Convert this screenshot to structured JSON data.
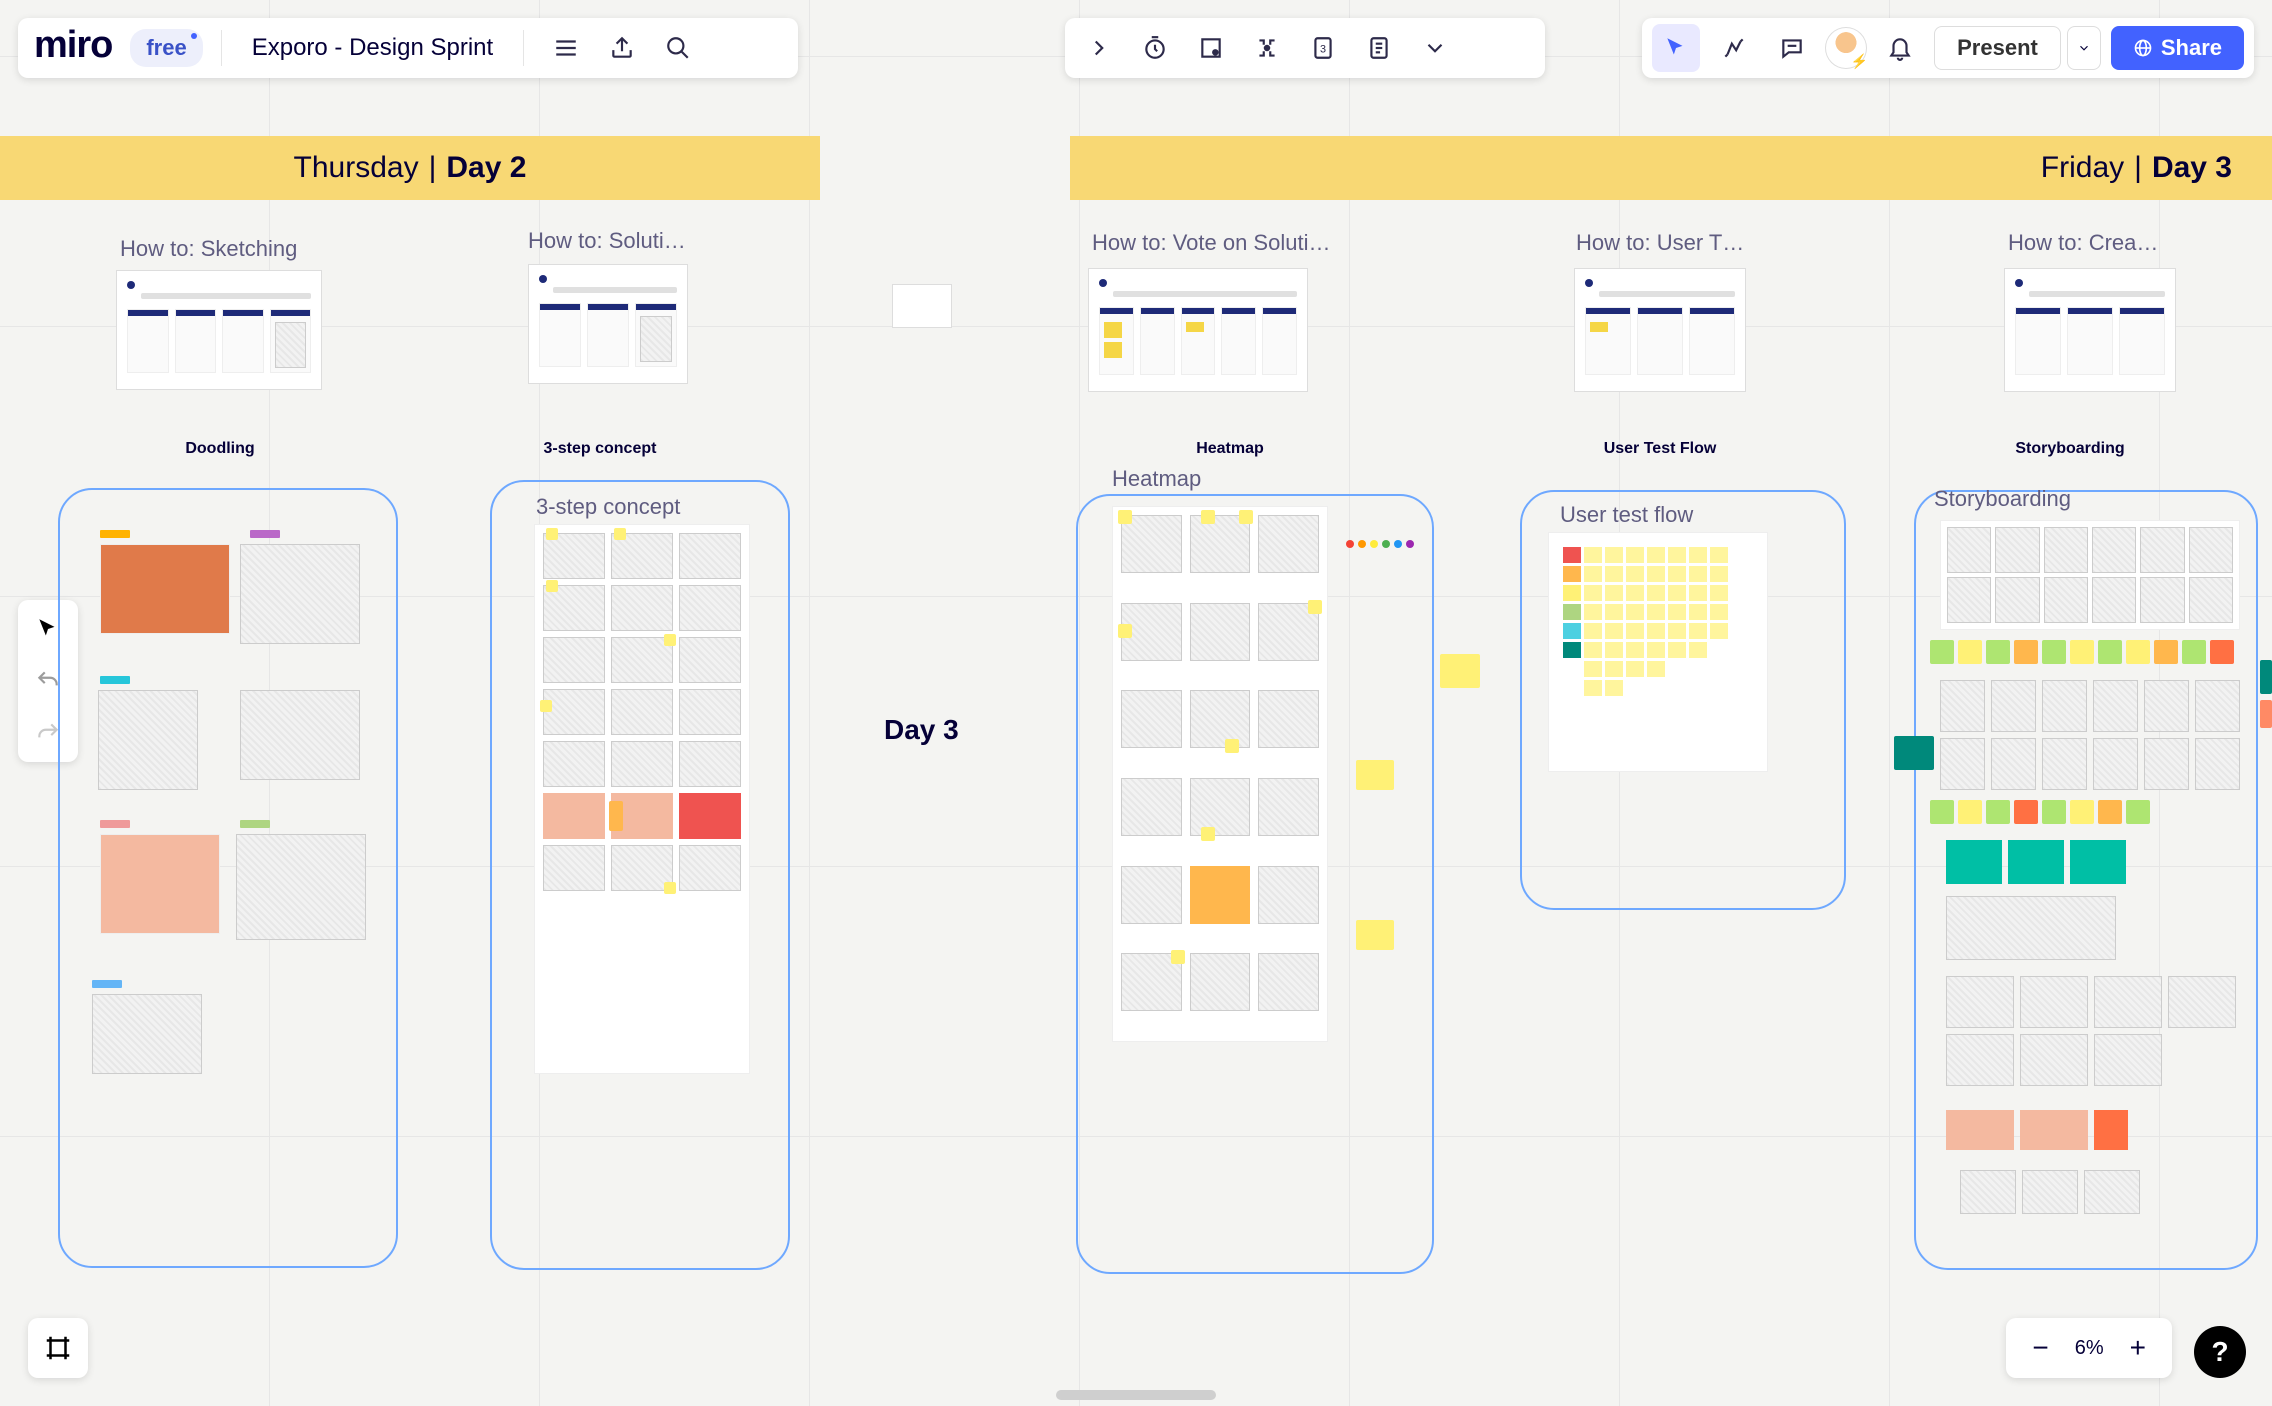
{
  "app": {
    "logo": "miro",
    "plan": "free",
    "board_title": "Exporo - Design Sprint"
  },
  "top_right": {
    "present": "Present",
    "share": "Share"
  },
  "zoom": {
    "percent": "6%"
  },
  "banners": {
    "day2_light": "Thursday",
    "day2_sep": "|",
    "day2_heavy": "Day 2",
    "day3_light": "Friday",
    "day3_sep": "|",
    "day3_heavy": "Day 3"
  },
  "howto": {
    "sketching": "How to: Sketching",
    "solutions": "How to: Soluti…",
    "vote": "How to: Vote on Soluti…",
    "usertest": "How to: User T…",
    "create": "How to: Crea…"
  },
  "sections": {
    "doodling": "Doodling",
    "threestep": "3-step concept",
    "heatmap_hdr": "Heatmap",
    "usertest_hdr": "User Test Flow",
    "storyboard_hdr": "Storyboarding"
  },
  "frames": {
    "threestep": "3-step concept",
    "heatmap": "Heatmap",
    "usertest": "User test flow",
    "storyboard": "Storyboarding"
  },
  "labels": {
    "day3": "Day 3"
  }
}
